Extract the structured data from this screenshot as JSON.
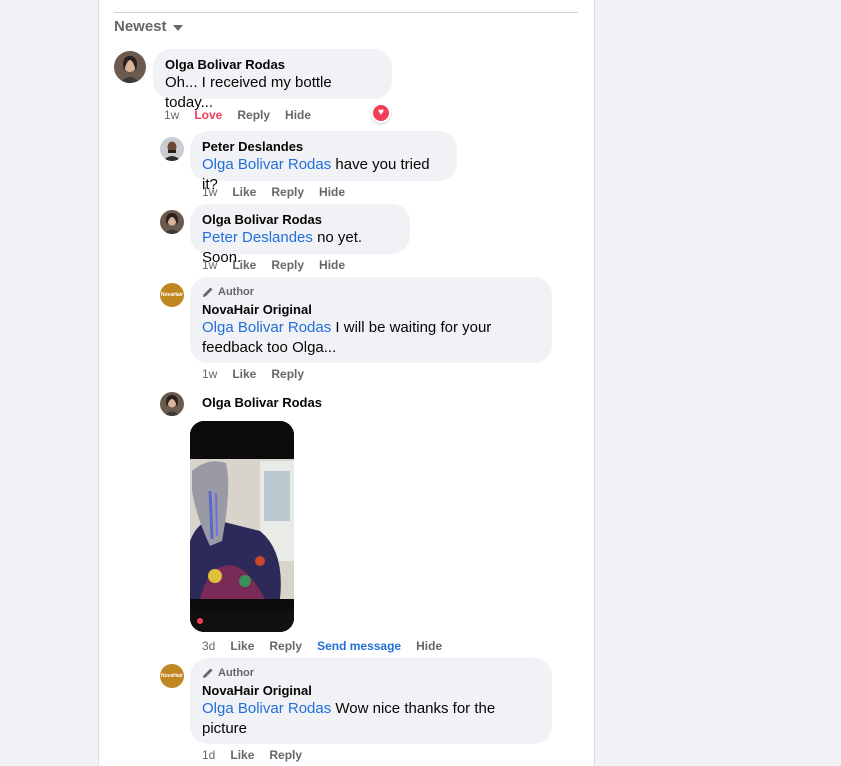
{
  "sort": {
    "label": "Newest"
  },
  "labels": {
    "author": "Author"
  },
  "comments": [
    {
      "name": "Olga Bolivar Rodas",
      "text": "Oh... I received my bottle today...",
      "time": "1w",
      "actions": [
        "Love",
        "Reply",
        "Hide"
      ],
      "reaction": "love"
    },
    {
      "name": "Peter Deslandes",
      "mention": "Olga Bolivar Rodas",
      "text": " have you tried it?",
      "time": "1w",
      "actions": [
        "Like",
        "Reply",
        "Hide"
      ]
    },
    {
      "name": "Olga Bolivar Rodas",
      "mention": "Peter Deslandes",
      "text": " no yet. Soon.",
      "time": "1w",
      "actions": [
        "Like",
        "Reply",
        "Hide"
      ]
    },
    {
      "name": "NovaHair Original",
      "logo_text": "NovaHair",
      "is_author": true,
      "mention": "Olga Bolivar Rodas",
      "text": " I will be waiting for your feedback too Olga...",
      "time": "1w",
      "actions": [
        "Like",
        "Reply"
      ]
    },
    {
      "name": "Olga Bolivar Rodas",
      "has_photo": true,
      "time": "3d",
      "actions": [
        "Like",
        "Reply",
        "Send message",
        "Hide"
      ]
    },
    {
      "name": "NovaHair Original",
      "logo_text": "NovaHair",
      "is_author": true,
      "mention": "Olga Bolivar Rodas",
      "text": " Wow nice thanks for the picture",
      "time": "1d",
      "actions": [
        "Like",
        "Reply"
      ]
    }
  ],
  "colors": {
    "mention": "#216fdb",
    "love": "#f33e58",
    "bubble": "#f0f2f5",
    "brand": "#c0861f"
  },
  "icons": [
    "chevron-down-icon",
    "heart-icon",
    "pencil-icon"
  ]
}
